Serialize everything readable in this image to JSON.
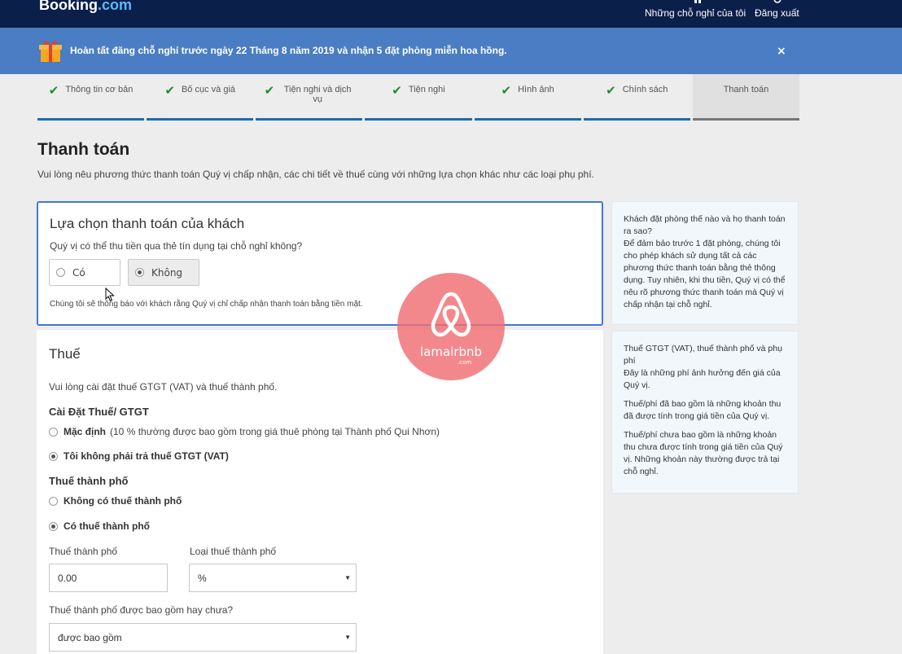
{
  "header": {
    "logo_main": "Booking",
    "logo_suffix": ".com",
    "my_properties": "Những chỗ nghỉ của tôi",
    "logout": "Đăng xuất"
  },
  "promo": {
    "text": "Hoàn tất đăng chỗ nghỉ trước ngày 22 Tháng 8 năm 2019 và nhận 5 đặt phòng miễn hoa hồng.",
    "close": "×"
  },
  "steps": [
    {
      "label": "Thông tin cơ bản",
      "done": true
    },
    {
      "label": "Bố cục và giá",
      "done": true
    },
    {
      "label": "Tiện nghi và dịch vụ",
      "done": true
    },
    {
      "label": "Tiện nghi",
      "done": true
    },
    {
      "label": "Hình ảnh",
      "done": true
    },
    {
      "label": "Chính sách",
      "done": true
    },
    {
      "label": "Thanh toán",
      "done": false
    }
  ],
  "check_glyph": "✔",
  "page": {
    "title": "Thanh toán",
    "subtitle": "Vui lòng nêu phương thức thanh toán Quý vị chấp nhận, các chi tiết về thuế cùng với những lựa chọn khác như các loại phụ phí."
  },
  "payment": {
    "heading": "Lựa chọn thanh toán của khách",
    "question": "Quý vị có thể thu tiền qua thẻ tín dụng tại chỗ nghỉ không?",
    "option_yes": "Có",
    "option_no": "Không",
    "selected": "Không",
    "note": "Chúng tôi sẽ thông báo với khách rằng Quý vị chỉ chấp nhận thanh toán bằng tiền mặt."
  },
  "tax": {
    "heading": "Thuế",
    "intro": "Vui lòng cài đặt thuế GTGT (VAT) và thuế thành phố.",
    "vat_heading": "Cài Đặt Thuế/ GTGT",
    "vat_default_label": "Mặc định",
    "vat_default_note": "(10 % thường được bao gồm trong giá thuê phòng tại Thành phố Qui Nhơn)",
    "vat_none": "Tôi không phải trả thuế GTGT (VAT)",
    "vat_selected": "none",
    "city_heading": "Thuế thành phố",
    "city_none": "Không có thuế thành phố",
    "city_has": "Có thuế thành phố",
    "city_selected": "has",
    "city_tax_label": "Thuế thành phố",
    "city_tax_value": "0.00",
    "city_tax_type_label": "Loại thuế thành phố",
    "city_tax_type_value": "%",
    "included_label": "Thuế thành phố được bao gồm hay chưa?",
    "included_value": "được bao gồm",
    "caret": "▼"
  },
  "sidebar": {
    "box1": {
      "title": "Khách đặt phòng thế nào và họ thanh toán ra sao?",
      "body": "Để đảm bảo trước 1 đặt phòng, chúng tôi cho phép khách sử dụng tất cả các phương thức thanh toán bằng thẻ thông dụng. Tuy nhiên, khi thu tiền, Quý vị có thể nêu rõ phương thức thanh toán mà Quý vị chấp nhận tại chỗ nghỉ."
    },
    "box2": {
      "title": "Thuế GTGT (VAT), thuế thành phố và phụ phí",
      "body": "Đây là những phí ảnh hưởng đến giá của Quý vị.",
      "included": "Thuế/phí đã bao gồm là những khoản thu đã được tính trong giá tiền của Quý vị.",
      "excluded": "Thuế/phí chưa bao gồm là những khoản thu chưa được tính trong giá tiền của Quý vị. Những khoản này thường được trả tại chỗ nghỉ."
    }
  },
  "watermark": {
    "text": "lamairbnb",
    "suffix": ".com",
    "color": "#f06e73"
  },
  "colors": {
    "topbar": "#0b1f4b",
    "promo": "#4a7dc3",
    "accent": "#3f7ad1",
    "check": "#1e8d2e"
  }
}
